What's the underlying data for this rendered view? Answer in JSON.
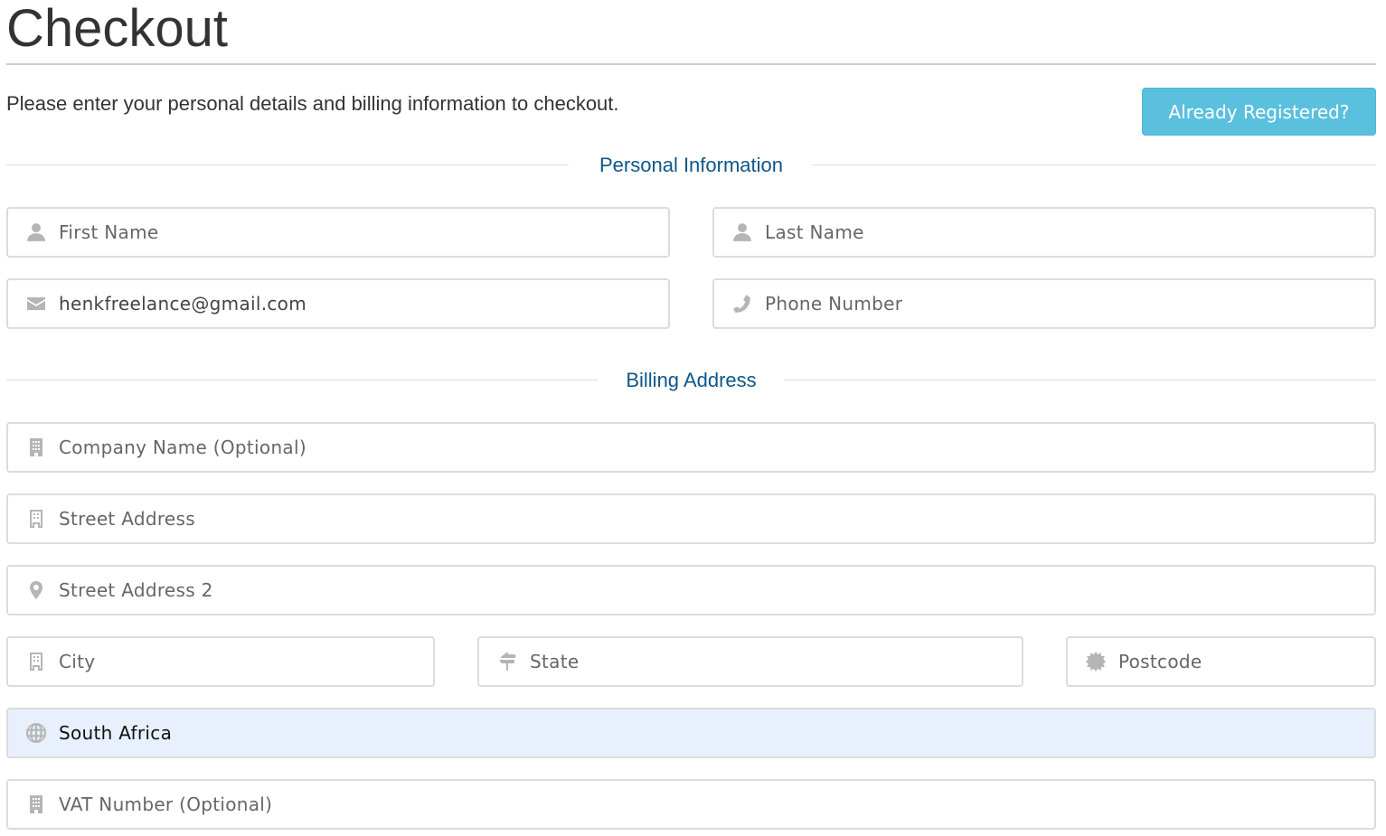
{
  "page": {
    "title": "Checkout",
    "intro": "Please enter your personal details and billing information to checkout.",
    "already_registered_label": "Already Registered?"
  },
  "colors": {
    "accent_button": "#5bc0de",
    "section_heading": "#0e5689",
    "autofill_background": "#e8f0fe"
  },
  "sections": {
    "personal": "Personal Information",
    "billing": "Billing Address"
  },
  "fields": {
    "first_name": {
      "icon": "user-icon",
      "placeholder": "First Name",
      "value": ""
    },
    "last_name": {
      "icon": "user-icon",
      "placeholder": "Last Name",
      "value": ""
    },
    "email": {
      "icon": "envelope-icon",
      "placeholder": "",
      "value": "henkfreelance@gmail.com"
    },
    "phone": {
      "icon": "phone-icon",
      "placeholder": "Phone Number",
      "value": ""
    },
    "company": {
      "icon": "building-icon",
      "placeholder": "Company Name (Optional)",
      "value": ""
    },
    "street1": {
      "icon": "building-outline-icon",
      "placeholder": "Street Address",
      "value": ""
    },
    "street2": {
      "icon": "map-marker-icon",
      "placeholder": "Street Address 2",
      "value": ""
    },
    "city": {
      "icon": "building-outline-icon",
      "placeholder": "City",
      "value": ""
    },
    "state": {
      "icon": "signpost-icon",
      "placeholder": "State",
      "value": ""
    },
    "postcode": {
      "icon": "certificate-icon",
      "placeholder": "Postcode",
      "value": ""
    },
    "country": {
      "icon": "globe-icon",
      "selected": "South Africa"
    },
    "vat": {
      "icon": "building-icon",
      "placeholder": "VAT Number (Optional)",
      "value": ""
    }
  }
}
